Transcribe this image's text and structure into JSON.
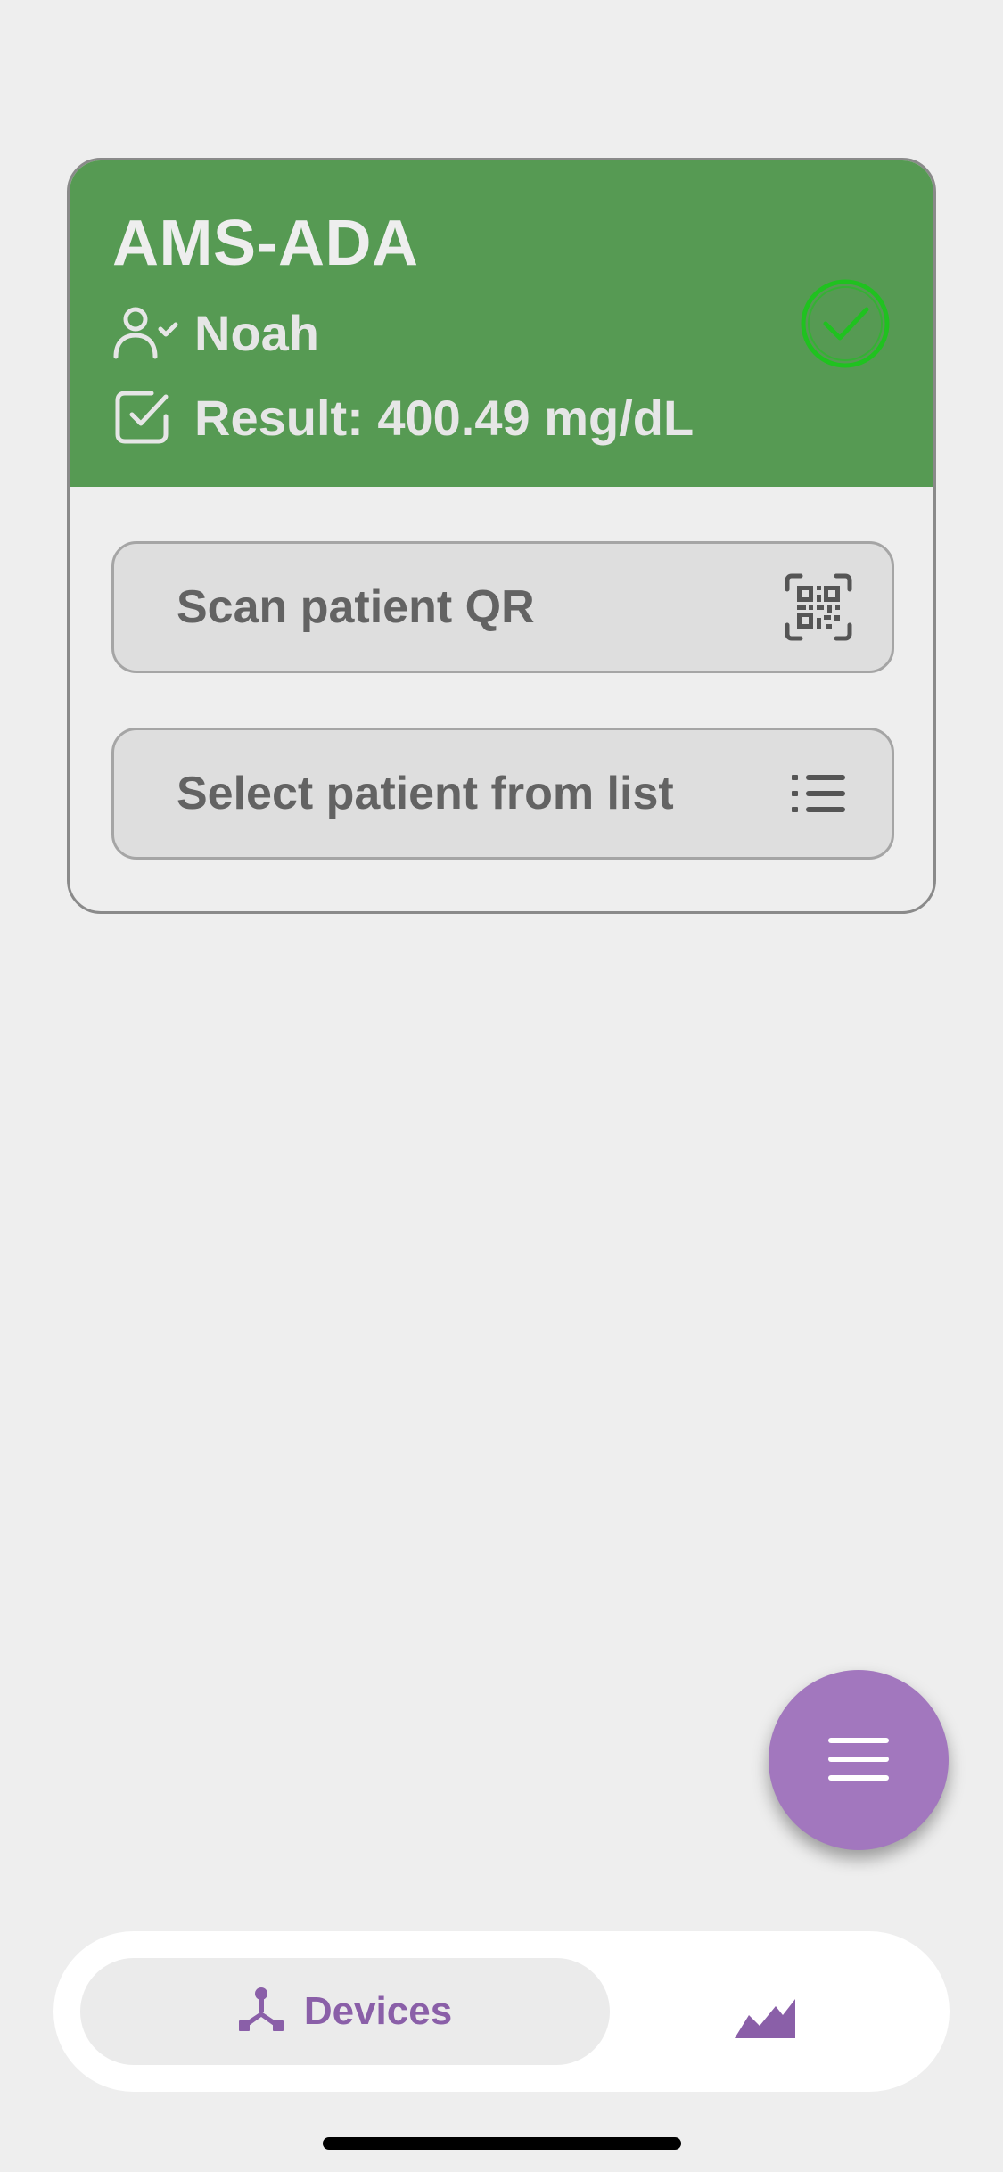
{
  "device": {
    "name": "AMS-ADA",
    "patient": "Noah",
    "result": "Result: 400.49 mg/dL",
    "status": "connected",
    "header_color": "#569a53",
    "check_color": "#1fc21f"
  },
  "actions": {
    "scan_label": "Scan patient QR",
    "scan_icon": "qr-code-scan-icon",
    "list_label": "Select patient from list",
    "list_icon": "list-icon"
  },
  "fab": {
    "icon": "hamburger-menu-icon",
    "color": "#a277be"
  },
  "bottom_nav": {
    "devices_label": "Devices",
    "devices_icon": "devices-network-icon",
    "chart_icon": "chart-area-icon",
    "accent_color": "#8a5fa8"
  }
}
